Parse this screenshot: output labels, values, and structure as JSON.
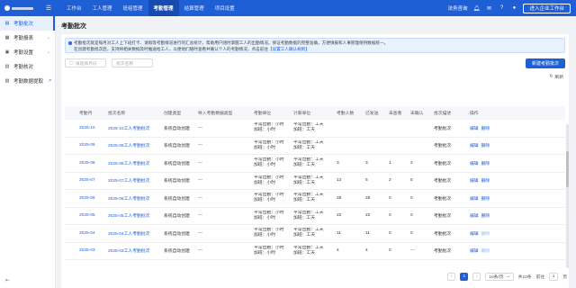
{
  "topbar": {
    "nav": [
      "工作台",
      "工人管理",
      "班组管理",
      "考勤管理",
      "结算管理",
      "项目设置"
    ],
    "active_index": 3,
    "right_text": "法务咨询",
    "enter_button": "进入企业工作台"
  },
  "sidebar": {
    "items": [
      {
        "label": "考勤批次",
        "active": true,
        "chevron": false,
        "external": false
      },
      {
        "label": "考勤报表",
        "active": false,
        "chevron": true,
        "external": false
      },
      {
        "label": "考勤设置",
        "active": false,
        "chevron": true,
        "external": false
      },
      {
        "label": "考勤核对",
        "active": false,
        "chevron": false,
        "external": false
      },
      {
        "label": "考勤数据提取",
        "active": false,
        "chevron": false,
        "external": true
      }
    ]
  },
  "page": {
    "title": "考勤批次",
    "notice_line1": "考勤批次就是每月对工人上下班打卡、请假等考勤情况进行的汇总统计，帮助用户随时掌握工人的出勤情况，保证考勤数据的完整准确，方便填报和人事管理保持数据统一。",
    "notice_line2": "在创建考勤批次后，支持将相关数据及时推送给工人，以便他们随时查看并确认个人的考勤情况，点击前往",
    "notice_link": "【设置工人确认规则】",
    "filter_month_placeholder": "请选择月份",
    "filter_name_placeholder": "批次名称",
    "new_button": "新建考勤批次",
    "refresh_label": "刷新"
  },
  "table": {
    "headers": [
      "考勤月",
      "批次名称",
      "创建类型",
      "导入考勤数据类型",
      "考勤单位",
      "计薪单位",
      "考勤人数",
      "已发送",
      "未查看",
      "未确认",
      "批次描述",
      "操作"
    ],
    "rows": [
      {
        "month": "2025-10",
        "name": "2025-10工人考勤批次",
        "create_type": "系统自动创建",
        "import_type": "---",
        "att_unit": [
          "平常出勤：小时",
          "加班：小时"
        ],
        "pay_unit": [
          "平常出勤：工天",
          "加班：工天"
        ],
        "count": "",
        "sent": "",
        "unviewed": "",
        "unconfirmed": "",
        "desc": "考勤批次",
        "actions": [
          "编辑",
          "删除"
        ],
        "delete_disabled": false
      },
      {
        "month": "2025-09",
        "name": "2025-09工人考勤批次",
        "create_type": "系统自动创建",
        "import_type": "---",
        "att_unit": [
          "平常出勤：小时",
          "加班：小时"
        ],
        "pay_unit": [
          "平常出勤：工天",
          "加班：工天"
        ],
        "count": "",
        "sent": "",
        "unviewed": "",
        "unconfirmed": "",
        "desc": "考勤批次",
        "actions": [
          "编辑",
          "删除"
        ],
        "delete_disabled": false
      },
      {
        "month": "2025-08",
        "name": "2025-08工人考勤批次",
        "create_type": "系统自动创建",
        "import_type": "---",
        "att_unit": [
          "平常出勤：小时",
          "加班：小时"
        ],
        "pay_unit": [
          "平常出勤：工天",
          "加班：工天"
        ],
        "count": "3",
        "sent": "3",
        "unviewed": "1",
        "unconfirmed": "2",
        "desc": "考勤批次",
        "actions": [
          "编辑",
          "删除"
        ],
        "delete_disabled": false
      },
      {
        "month": "2025-07",
        "name": "2025-07工人考勤批次",
        "create_type": "系统自动创建",
        "import_type": "---",
        "att_unit": [
          "平常出勤：小时",
          "加班：小时"
        ],
        "pay_unit": [
          "平常出勤：工天",
          "加班：工天"
        ],
        "count": "12",
        "sent": "5",
        "unviewed": "2",
        "unconfirmed": "5",
        "desc": "考勤批次",
        "actions": [
          "编辑",
          "删除"
        ],
        "delete_disabled": false
      },
      {
        "month": "2025-06",
        "name": "2025-06工人考勤批次",
        "create_type": "系统自动创建",
        "import_type": "---",
        "att_unit": [
          "平常出勤：小时",
          "加班：小时"
        ],
        "pay_unit": [
          "平常出勤：工天",
          "加班：工天"
        ],
        "count": "26",
        "sent": "26",
        "unviewed": "0",
        "unconfirmed": "0",
        "desc": "考勤批次",
        "actions": [
          "编辑",
          "删除"
        ],
        "delete_disabled": false
      },
      {
        "month": "2025-05",
        "name": "2025-05工人考勤批次",
        "create_type": "系统自动创建",
        "import_type": "---",
        "att_unit": [
          "平常出勤：小时",
          "加班：小时"
        ],
        "pay_unit": [
          "平常出勤：工天",
          "加班：工天"
        ],
        "count": "22",
        "sent": "22",
        "unviewed": "0",
        "unconfirmed": "0",
        "desc": "考勤批次",
        "actions": [
          "编辑",
          "删除"
        ],
        "delete_disabled": false
      },
      {
        "month": "2025-04",
        "name": "2025-04工人考勤批次",
        "create_type": "系统自动创建",
        "import_type": "---",
        "att_unit": [
          "平常出勤：小时",
          "加班：小时"
        ],
        "pay_unit": [
          "平常出勤：工天",
          "加班：工天"
        ],
        "count": "11",
        "sent": "11",
        "unviewed": "0",
        "unconfirmed": "0",
        "desc": "考勤批次",
        "actions": [
          "编辑",
          "删除"
        ],
        "delete_disabled": true
      },
      {
        "month": "2025-03",
        "name": "2025-03工人考勤批次",
        "create_type": "系统自动创建",
        "import_type": "---",
        "att_unit": [
          "平常出勤：小时",
          "加班：小时"
        ],
        "pay_unit": [
          "平常出勤：工天",
          "加班：工天"
        ],
        "count": "4",
        "sent": "4",
        "unviewed": "0",
        "unconfirmed": "---",
        "desc": "考勤批次",
        "actions": [
          "编辑",
          "删除"
        ],
        "delete_disabled": true
      }
    ]
  },
  "pagination": {
    "current_page": "1",
    "page_size": "10条/页",
    "total": "共10条",
    "goto_label": "前往",
    "goto_value": "1",
    "page_unit": "页"
  },
  "colors": {
    "primary": "#1f5fd6",
    "topbar": "#1f5fd6",
    "notice_bg": "#e8f1fe"
  }
}
